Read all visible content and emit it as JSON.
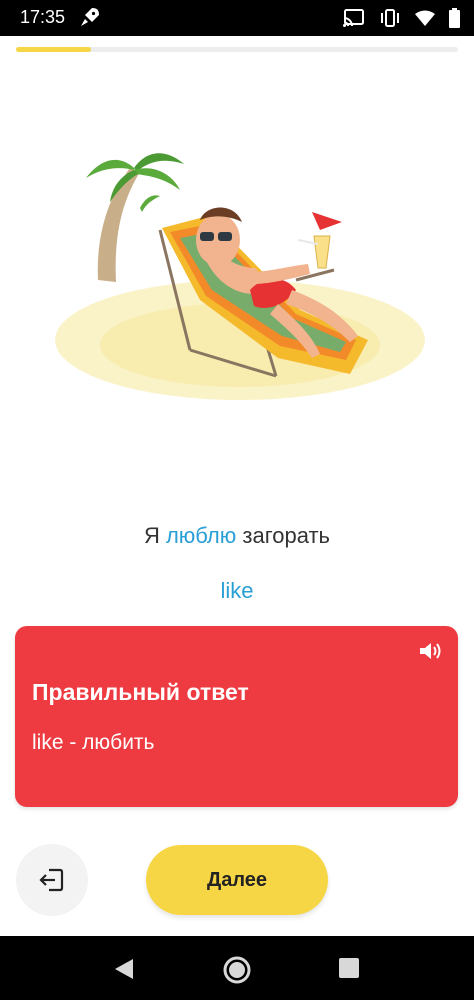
{
  "status_bar": {
    "time": "17:35",
    "icons": [
      "rocket-icon",
      "cast-icon",
      "vibrate-icon",
      "wifi-icon",
      "battery-icon"
    ]
  },
  "progress": {
    "fraction": 0.17,
    "color": "#f7d645"
  },
  "illustration": {
    "subject": "man-relaxing-on-deck-chair-under-palm"
  },
  "exercise": {
    "sentence_prefix": "Я ",
    "sentence_highlight": "люблю",
    "sentence_suffix": " загорать",
    "selected_answer": "like"
  },
  "feedback": {
    "title": "Правильный ответ",
    "detail": "like - любить",
    "background_color": "#ee3b41",
    "speaker_icon": "speaker-icon"
  },
  "buttons": {
    "exit_icon": "exit-icon",
    "next_label": "Далее",
    "next_color": "#f7d645"
  },
  "nav_bar": {
    "icons": [
      "back-icon",
      "home-icon",
      "recents-icon"
    ]
  }
}
